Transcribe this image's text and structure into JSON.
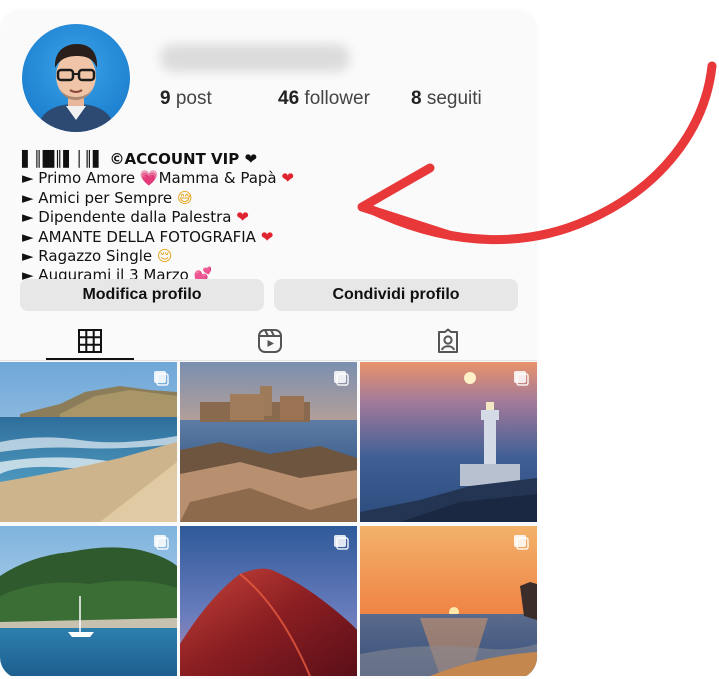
{
  "profile": {
    "stats": {
      "posts_num": "9",
      "posts_label": "post",
      "followers_num": "46",
      "followers_label": "follower",
      "following_num": "8",
      "following_label": "seguiti"
    },
    "bio": {
      "title": "▌║█║▌│║▌ ©ACCOUNT VIP ❤",
      "lines": [
        {
          "text": "► Primo Amore ",
          "emoji": "💗",
          "text2": "Mamma & Papà ",
          "emoji2": "❤"
        },
        {
          "text": "► Amici per Sempre ",
          "emoji": "😅"
        },
        {
          "text": "► Dipendente dalla Palestra ",
          "emoji": "❤"
        },
        {
          "text": "► AMANTE DELLA FOTOGRAFIA ",
          "emoji": "❤"
        },
        {
          "text": "► Ragazzo Single ",
          "emoji": "😌"
        },
        {
          "text": "► Augurami il 3 Marzo ",
          "emoji": "💕"
        }
      ]
    }
  },
  "actions": {
    "edit_label": "Modifica profilo",
    "share_label": "Condividi profilo"
  },
  "tabs": {
    "icons": [
      "grid-icon",
      "reels-icon",
      "tagged-icon"
    ],
    "active": "grid-icon"
  },
  "colors": {
    "accent_arrow": "#e8383a",
    "button_bg": "#e7e7e7",
    "card_bg": "#fafafa"
  }
}
